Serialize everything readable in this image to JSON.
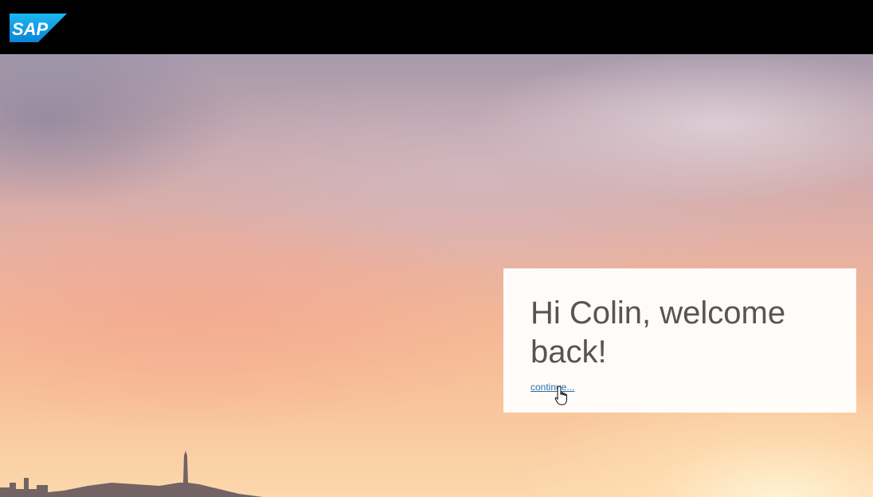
{
  "header": {
    "logo_text": "SAP",
    "background_color": "#000000",
    "logo_color": "#1a9fe0"
  },
  "welcome": {
    "title": "Hi Colin, welcome back!",
    "continue_label": "continue..."
  },
  "pointer": {
    "icon": "hand-pointer-icon"
  }
}
